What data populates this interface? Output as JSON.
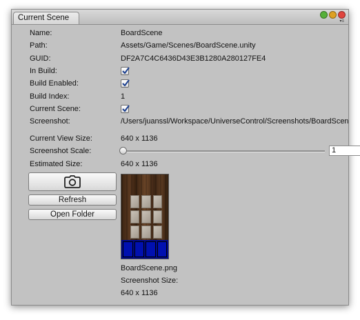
{
  "window": {
    "tab_title": "Current Scene"
  },
  "fields": {
    "name": {
      "label": "Name:",
      "value": "BoardScene"
    },
    "path": {
      "label": "Path:",
      "value": "Assets/Game/Scenes/BoardScene.unity"
    },
    "guid": {
      "label": "GUID:",
      "value": "DF2A7C4C6436D43E3B1280A280127FE4"
    },
    "in_build": {
      "label": "In Build:",
      "checked": true
    },
    "build_enabled": {
      "label": "Build Enabled:",
      "checked": true
    },
    "build_index": {
      "label": "Build Index:",
      "value": "1"
    },
    "current_scene": {
      "label": "Current Scene:",
      "checked": true
    },
    "screenshot": {
      "label": "Screenshot:",
      "value": "/Users/juanssl/Workspace/UniverseControl/Screenshots/BoardScene.png"
    },
    "current_view_size": {
      "label": "Current View Size:",
      "value": "640 x 1136"
    },
    "screenshot_scale": {
      "label": "Screenshot Scale:",
      "value": "1",
      "slider_fraction": 0.0
    },
    "estimated_size": {
      "label": "Estimated Size:",
      "value": "640 x 1136"
    }
  },
  "buttons": {
    "capture_icon": "camera-icon",
    "refresh": "Refresh",
    "open_folder": "Open Folder"
  },
  "preview": {
    "filename": "BoardScene.png",
    "size_label": "Screenshot Size:",
    "size_value": "640 x 1136"
  },
  "colors": {
    "window_bg": "#c2c2c2",
    "close_light": "#e0443e",
    "minimize_light": "#dea123",
    "zoom_light": "#55b03a",
    "check_color": "#1b3f8f"
  }
}
